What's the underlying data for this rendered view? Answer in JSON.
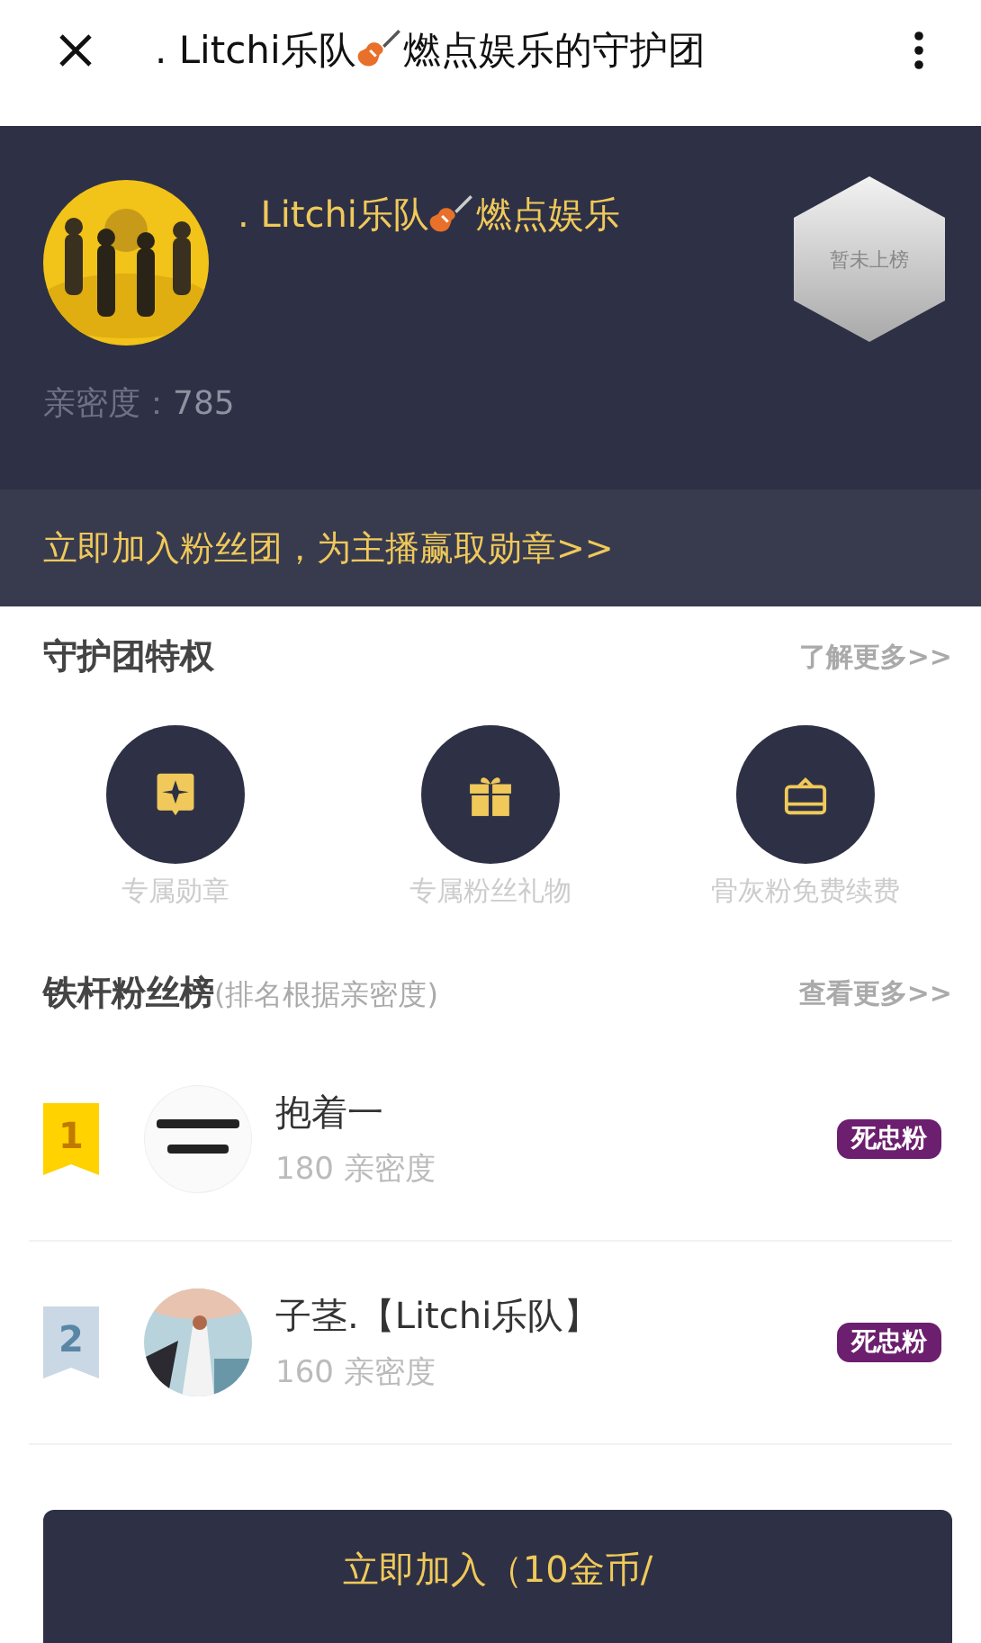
{
  "header": {
    "title_before": ". Litchi乐队",
    "title_after": "燃点娱乐的守护团"
  },
  "streamer": {
    "name_before": ". Litchi乐队",
    "name_after": "燃点娱乐",
    "rank_badge": "暂未上榜",
    "intimacy_label": "亲密度：",
    "intimacy_value": "785"
  },
  "join_banner": "立即加入粉丝团，为主播赢取勋章>>",
  "privileges": {
    "title": "守护团特权",
    "more": "了解更多>>",
    "items": [
      {
        "kind": "medal",
        "label": "专属勋章"
      },
      {
        "kind": "gift",
        "label": "专属粉丝礼物"
      },
      {
        "kind": "card",
        "label": "骨灰粉免费续费"
      }
    ]
  },
  "leaderboard": {
    "title": "铁杆粉丝榜",
    "note": "(排名根据亲密度)",
    "more": "查看更多>>",
    "rows": [
      {
        "rank": "1",
        "color": "#ffd200",
        "name": "抱着一",
        "score": "180 亲密度",
        "tag": "死忠粉"
      },
      {
        "rank": "2",
        "color": "#c9d8e4",
        "name": "子茎.【Litchi乐队】",
        "score": "160 亲密度",
        "tag": "死忠粉"
      }
    ]
  },
  "join_button": "立即加入（10金币/"
}
